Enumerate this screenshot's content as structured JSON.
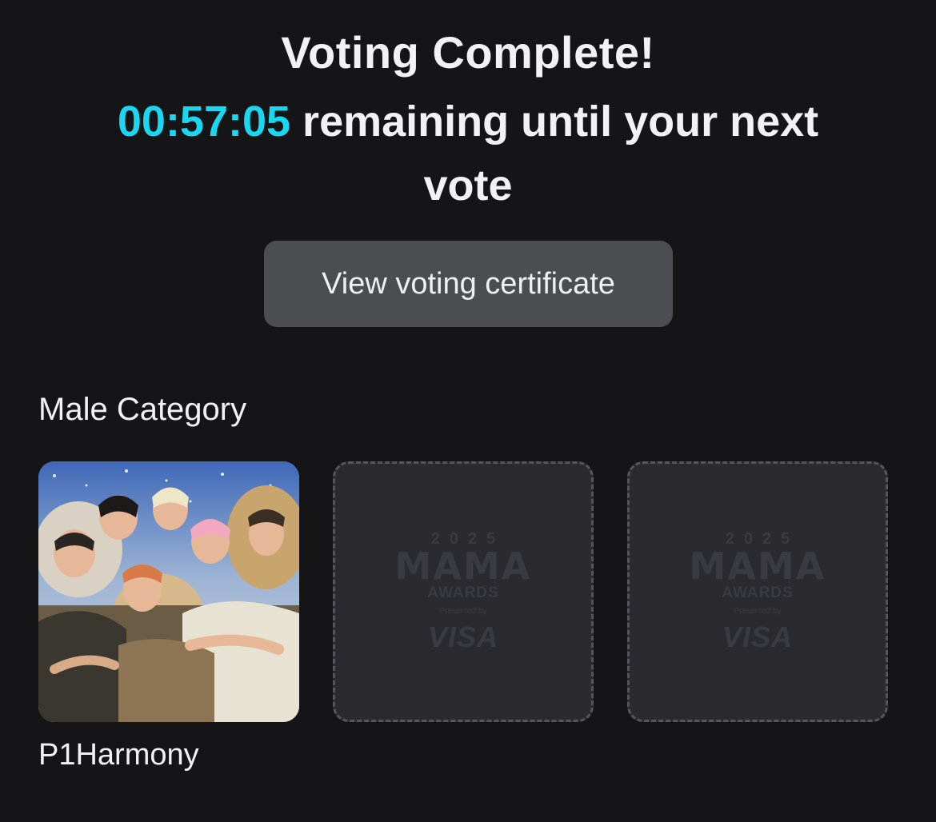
{
  "header": {
    "title": "Voting Complete!",
    "timer": "00:57:05",
    "countdown_suffix": " remaining until your next vote"
  },
  "actions": {
    "certificate_label": "View voting certificate"
  },
  "category": {
    "title": "Male Category",
    "slots": [
      {
        "state": "filled",
        "artist": "P1Harmony"
      },
      {
        "state": "empty"
      },
      {
        "state": "empty"
      }
    ]
  },
  "placeholder_logo": {
    "year": "2025",
    "brand": "MAMA",
    "awards": "AWARDS",
    "presented_by": "Presented by",
    "sponsor": "VISA"
  },
  "colors": {
    "background": "#151517",
    "timer_accent": "#19d7f0",
    "button_bg": "#4c4d51",
    "slot_bg": "#2b2b2f"
  }
}
